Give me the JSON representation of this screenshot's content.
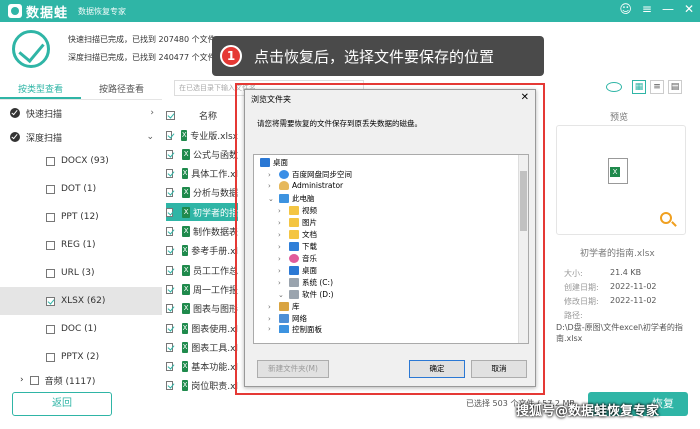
{
  "app": {
    "brand": "数据蛙",
    "subtitle": "数据恢复专家",
    "win_controls": [
      "☺",
      "≡",
      "—",
      "✕"
    ]
  },
  "scan": {
    "quick": "快速扫描已完成，已找到 207480 个文件 (25.5 GB)",
    "deep": "深度扫描已完成，已找到 240477 个文件"
  },
  "tooltip": {
    "step": "1",
    "text": "点击恢复后，选择文件要保存的位置"
  },
  "left_tabs": [
    "按类型查看",
    "按路径查看"
  ],
  "tree": {
    "quick_scan": "快速扫描",
    "deep_scan": "深度扫描",
    "items": [
      {
        "label": "DOCX (93)",
        "checked": false
      },
      {
        "label": "DOT (1)",
        "checked": false
      },
      {
        "label": "PPT (12)",
        "checked": false
      },
      {
        "label": "REG (1)",
        "checked": false
      },
      {
        "label": "URL (3)",
        "checked": false
      },
      {
        "label": "XLSX (62)",
        "checked": true
      },
      {
        "label": "DOC (1)",
        "checked": false
      },
      {
        "label": "PPTX (2)",
        "checked": false
      }
    ],
    "audio": "音频 (1117)"
  },
  "list": {
    "search_placeholder": "在已选目录下输入文件名",
    "name_header": "名称",
    "files": [
      "专业版.xlsx",
      "公式与函数",
      "具体工作.xl",
      "分析与数据",
      "初学者的指",
      "制作数据表",
      "参考手册.xl",
      "员工工作总",
      "周一工作报",
      "图表与图形",
      "图表使用.xl",
      "图表工具.xl",
      "基本功能.xl",
      "岗位职责.xl"
    ],
    "selected_index": 4
  },
  "preview": {
    "title": "预览",
    "file_name": "初学者的指南.xlsx",
    "meta": [
      {
        "label": "大小:",
        "value": "21.4 KB"
      },
      {
        "label": "创建日期:",
        "value": "2022-11-02"
      },
      {
        "label": "修改日期:",
        "value": "2022-11-02"
      },
      {
        "label": "路径:",
        "value": ""
      }
    ],
    "path": "D:\\D盘-原图\\文件excel\\初学者的指南.xlsx"
  },
  "bottom": {
    "back": "返回",
    "selected": "已选择 503 个文件 / 57.2 MB",
    "recover": "恢复"
  },
  "watermark": "搜狐号@数据蛙恢复专家",
  "dialog": {
    "title": "浏览文件夹",
    "close": "✕",
    "message": "请您将需要恢复的文件保存到原丢失数据的磁盘。",
    "nodes": {
      "desktop": "桌面",
      "baidu": "百度网盘同步空间",
      "admin": "Administrator",
      "thispc": "此电脑",
      "video": "视频",
      "pictures": "图片",
      "docs": "文档",
      "download": "下载",
      "music": "音乐",
      "desk2": "桌面",
      "sysc": "系统 (C:)",
      "softd": "软件 (D:)",
      "library": "库",
      "network": "网络",
      "control": "控制面板"
    },
    "new_folder": "新建文件夹(M)",
    "ok": "确定",
    "cancel": "取消"
  }
}
